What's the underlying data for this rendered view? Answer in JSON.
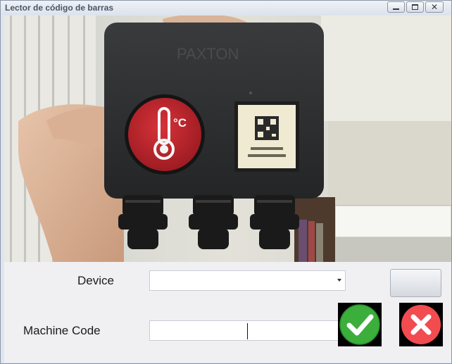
{
  "window": {
    "title": "Lector de código de barras"
  },
  "controls": {
    "device_label": "Device",
    "device_value": "",
    "machine_code_label": "Machine Code",
    "machine_code_value": ""
  },
  "icons": {
    "minimize": "minimize-icon",
    "maximize": "maximize-icon",
    "close": "close-icon",
    "accept": "check-circle-icon",
    "cancel": "x-circle-icon"
  },
  "colors": {
    "accept": "#3cae3c",
    "cancel": "#f24b50"
  }
}
